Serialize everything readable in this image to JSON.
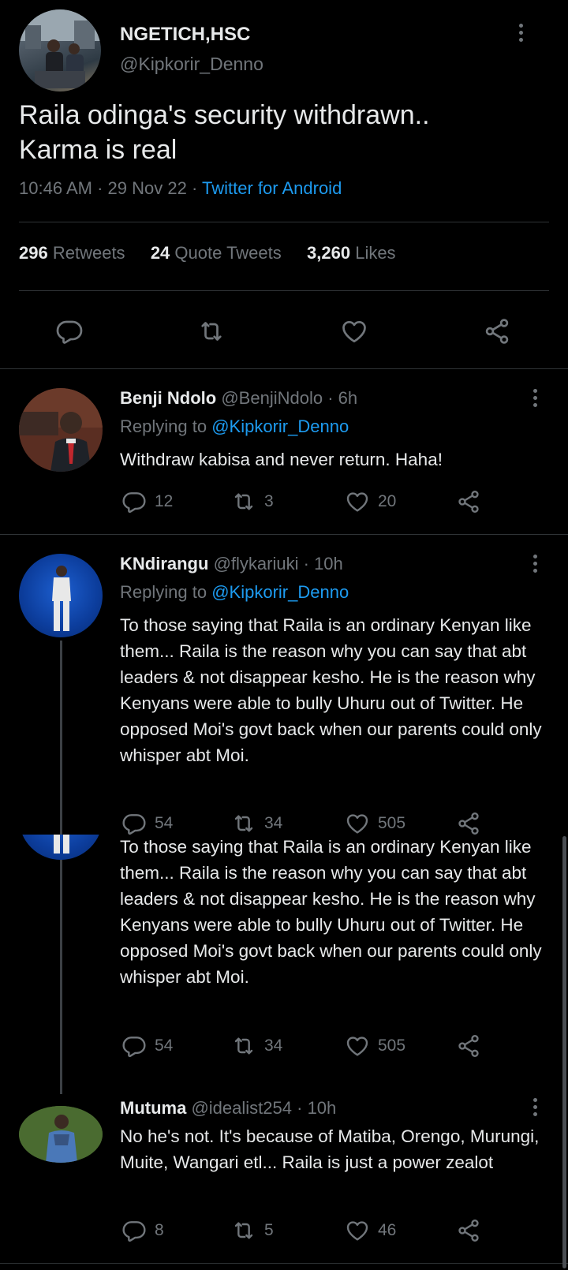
{
  "main_tweet": {
    "author_name": "NGETICH,HSC",
    "author_handle": "@Kipkorir_Denno",
    "text_line1": "Raila odinga's security withdrawn..",
    "text_line2": "Karma is real",
    "time": "10:46 AM",
    "date": "29 Nov 22",
    "source": "Twitter for Android",
    "retweets_count": "296",
    "retweets_label": "Retweets",
    "quotes_count": "24",
    "quotes_label": "Quote Tweets",
    "likes_count": "3,260",
    "likes_label": "Likes"
  },
  "replies": [
    {
      "name": "Benji Ndolo",
      "handle": "@BenjiNdolo",
      "time": "6h",
      "replying_label": "Replying to",
      "replying_to": "@Kipkorir_Denno",
      "text": "Withdraw kabisa and never return. Haha!",
      "reply_count": "12",
      "retweet_count": "3",
      "like_count": "20"
    },
    {
      "name": "KNdirangu",
      "handle": "@flykariuki",
      "time": "10h",
      "replying_label": "Replying to",
      "replying_to": "@Kipkorir_Denno",
      "text": "To those saying that Raila is an ordinary Kenyan like them... Raila is the reason why you can say that abt leaders & not disappear kesho. He is the reason why Kenyans were able to bully Uhuru out of Twitter. He opposed Moi's govt back when our parents could only whisper abt Moi.",
      "reply_count": "54",
      "retweet_count": "34",
      "like_count": "505"
    },
    {
      "name": "Mutuma",
      "handle": "@idealist254",
      "time": "10h",
      "text": "No he's not. It's because of Matiba, Orengo, Murungi, Muite, Wangari etl...  Raila is just a power zealot",
      "reply_count": "8",
      "retweet_count": "5",
      "like_count": "46"
    }
  ],
  "colors": {
    "background": "#000000",
    "text": "#e7e9ea",
    "muted": "#71767b",
    "link": "#1d9bf0",
    "divider": "#2f3336"
  }
}
